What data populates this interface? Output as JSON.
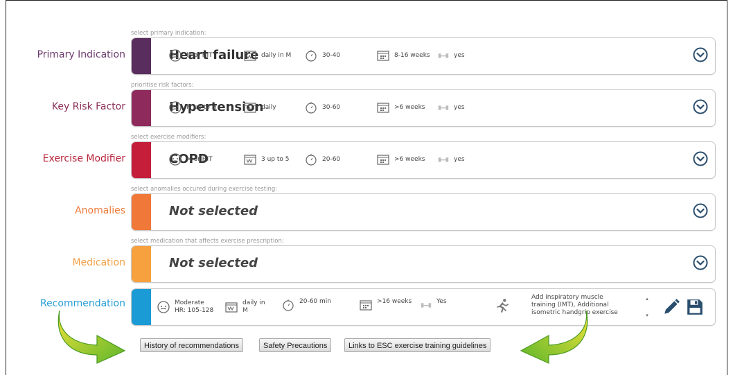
{
  "rows": [
    {
      "label": "Primary Indication",
      "hint": "select primary indication:",
      "title": "Heart failure",
      "color": "#5a2d5f",
      "label_color": "#6a3b6e",
      "intensity": "M or HIT",
      "frequency": "daily in M",
      "duration": "30-40",
      "period": "8-16 weeks",
      "resistance": "yes"
    },
    {
      "label": "Key Risk Factor",
      "hint": "prioritise risk factors:",
      "title": "Hypertension",
      "color": "#8e2a5c",
      "label_color": "#8a2f55",
      "intensity": "M up to H",
      "frequency": "daily",
      "duration": "30-60",
      "period": ">6 weeks",
      "resistance": "yes"
    },
    {
      "label": "Exercise Modifier",
      "hint": "select exercise modifiers:",
      "title": "COPD",
      "color": "#c41e3a",
      "label_color": "#b8223a",
      "intensity": "M or HIT",
      "frequency": "3 up to 5",
      "duration": "20-60",
      "period": ">6 weeks",
      "resistance": "yes"
    },
    {
      "label": "Anomalies",
      "hint": "select anomalies occured during exercise testing:",
      "title": "Not selected",
      "color": "#f07838",
      "label_color": "#ef7a38"
    },
    {
      "label": "Medication",
      "hint": "select medication that affects exercise prescription:",
      "title": "Not selected",
      "color": "#f6a03e",
      "label_color": "#f1a045"
    }
  ],
  "recommendation": {
    "label": "Recommendation",
    "color": "#1b9bd6",
    "label_color": "#2a9ed6",
    "intensity_1": "Moderate",
    "intensity_2": "HR: 105-128",
    "frequency_1": "daily in",
    "frequency_2": "M",
    "duration": "20-60 min",
    "period": ">16 weeks",
    "resistance": "Yes",
    "text_1": "Add inspiratory muscle",
    "text_2": "training (IMT), Additional",
    "text_3": "isometric handgrip exercise"
  },
  "buttons": {
    "history": "History of recommendations",
    "safety": "Safety Precautions",
    "links": "Links to ESC exercise training guidelines"
  },
  "icons": {
    "intensity": "face-gauge-icon",
    "frequency": "calendar-week-icon",
    "duration": "stopwatch-icon",
    "period": "calendar-grid-icon",
    "resistance": "dumbbell-icon",
    "expand": "chevron-down-circle-icon",
    "runner": "runner-icon",
    "edit": "pencil-icon",
    "save": "floppy-disk-icon"
  },
  "arrow_color": "#8cc63f"
}
